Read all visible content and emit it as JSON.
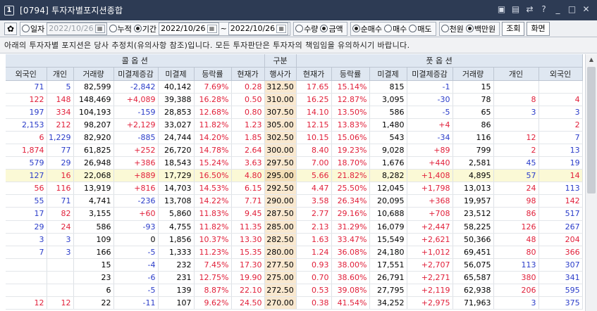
{
  "window": {
    "num": "1",
    "title": "[0794] 투자자별포지션종합",
    "icons": [
      "save-icon",
      "window-icon",
      "link-icon",
      "help-icon",
      "minimize-icon",
      "maximize-icon",
      "close-icon"
    ],
    "icon_glyphs": [
      "▣",
      "▤",
      "⇄",
      "?",
      "_",
      "□",
      "✕"
    ]
  },
  "toolbar": {
    "gear_glyph": "✿",
    "period": {
      "daily_label": "일자",
      "daily_date": "2022/10/26",
      "cumulative_label": "누적",
      "range_label": "기간",
      "from": "2022/10/26",
      "tilde": "~",
      "to": "2022/10/26"
    },
    "unit": {
      "qty_label": "수량",
      "amount_label": "금액"
    },
    "side": {
      "net_label": "순매수",
      "buy_label": "매수",
      "sell_label": "매도"
    },
    "money": {
      "won_label": "천원",
      "million_label": "백만원"
    },
    "query_label": "조회",
    "screen_label": "화면"
  },
  "notice": "아래의 투자자별 포지션은 당사 추정치(유의사항 참조)입니다. 모든 투자판단은 투자자의 책임임을 유의하시기 바랍니다.",
  "headers": {
    "call": "콜 옵 션",
    "center": "구분",
    "put": "풋 옵 션",
    "columns": [
      "외국인",
      "개인",
      "거래량",
      "미결제증감",
      "미결제",
      "등락률",
      "현재가",
      "행사가",
      "현재가",
      "등락률",
      "미결제",
      "미결제증감",
      "거래량",
      "개인",
      "외국인"
    ]
  },
  "colors": {
    "red": "#e1203a",
    "blue": "#2a3cc9",
    "header": "#dfe7f1",
    "strike_bg": "#f9e8cf",
    "title_bg": "#2d3b54"
  },
  "rows": [
    [
      "71",
      "5",
      "82,599",
      "-2,842",
      "40,142",
      "7.69%",
      "0.28",
      "312.50",
      "17.65",
      "15.14%",
      "815",
      "-1",
      "15",
      "",
      ""
    ],
    [
      "122",
      "148",
      "148,469",
      "+4,089",
      "39,388",
      "16.28%",
      "0.50",
      "310.00",
      "16.25",
      "12.87%",
      "3,095",
      "-30",
      "78",
      "8",
      "4"
    ],
    [
      "197",
      "334",
      "104,193",
      "-159",
      "28,853",
      "12.68%",
      "0.80",
      "307.50",
      "14.10",
      "13.50%",
      "586",
      "-5",
      "65",
      "3",
      "3"
    ],
    [
      "2,153",
      "212",
      "98,207",
      "+2,129",
      "33,027",
      "11.82%",
      "1.23",
      "305.00",
      "12.15",
      "13.83%",
      "1,480",
      "+4",
      "86",
      "",
      "2"
    ],
    [
      "6",
      "1,229",
      "82,920",
      "-885",
      "24,744",
      "14.20%",
      "1.85",
      "302.50",
      "10.15",
      "15.06%",
      "543",
      "-34",
      "116",
      "12",
      "7"
    ],
    [
      "1,874",
      "77",
      "61,825",
      "+252",
      "26,720",
      "14.78%",
      "2.64",
      "300.00",
      "8.40",
      "19.23%",
      "9,028",
      "+89",
      "799",
      "2",
      "13"
    ],
    [
      "579",
      "29",
      "26,948",
      "+386",
      "18,543",
      "15.24%",
      "3.63",
      "297.50",
      "7.00",
      "18.70%",
      "1,676",
      "+440",
      "2,581",
      "45",
      "19"
    ],
    [
      "127",
      "16",
      "22,068",
      "+889",
      "17,729",
      "16.50%",
      "4.80",
      "295.00",
      "5.66",
      "21.82%",
      "8,282",
      "+1,408",
      "4,895",
      "57",
      "14"
    ],
    [
      "56",
      "116",
      "13,919",
      "+816",
      "14,703",
      "14.53%",
      "6.15",
      "292.50",
      "4.47",
      "25.50%",
      "12,045",
      "+1,798",
      "13,013",
      "24",
      "113"
    ],
    [
      "55",
      "71",
      "4,741",
      "-236",
      "13,708",
      "14.22%",
      "7.71",
      "290.00",
      "3.58",
      "26.34%",
      "20,095",
      "+368",
      "19,957",
      "98",
      "142"
    ],
    [
      "17",
      "82",
      "3,155",
      "+60",
      "5,860",
      "11.83%",
      "9.45",
      "287.50",
      "2.77",
      "29.16%",
      "10,688",
      "+708",
      "23,512",
      "86",
      "517"
    ],
    [
      "29",
      "24",
      "586",
      "-93",
      "4,755",
      "11.82%",
      "11.35",
      "285.00",
      "2.13",
      "31.29%",
      "16,079",
      "+2,447",
      "58,225",
      "126",
      "267"
    ],
    [
      "3",
      "3",
      "109",
      "0",
      "1,856",
      "10.37%",
      "13.30",
      "282.50",
      "1.63",
      "33.47%",
      "15,549",
      "+2,621",
      "50,366",
      "48",
      "204"
    ],
    [
      "7",
      "3",
      "166",
      "-5",
      "1,333",
      "11.23%",
      "15.35",
      "280.00",
      "1.24",
      "36.08%",
      "24,180",
      "+1,012",
      "69,451",
      "80",
      "366"
    ],
    [
      "",
      "",
      "15",
      "-4",
      "232",
      "7.45%",
      "17.30",
      "277.50",
      "0.93",
      "38.00%",
      "17,551",
      "+2,707",
      "56,075",
      "113",
      "307"
    ],
    [
      "",
      "",
      "23",
      "-6",
      "231",
      "12.75%",
      "19.90",
      "275.00",
      "0.70",
      "38.60%",
      "26,791",
      "+2,271",
      "65,587",
      "380",
      "341"
    ],
    [
      "",
      "",
      "6",
      "-5",
      "139",
      "8.87%",
      "22.10",
      "272.50",
      "0.53",
      "39.08%",
      "27,795",
      "+2,119",
      "62,938",
      "206",
      "595"
    ],
    [
      "12",
      "12",
      "22",
      "-11",
      "107",
      "9.62%",
      "24.50",
      "270.00",
      "0.38",
      "41.54%",
      "34,252",
      "+2,975",
      "71,963",
      "3",
      "375"
    ]
  ],
  "highlight_row": 7,
  "scrollbar": {
    "up_glyph": "▲",
    "down_glyph": "▼"
  }
}
